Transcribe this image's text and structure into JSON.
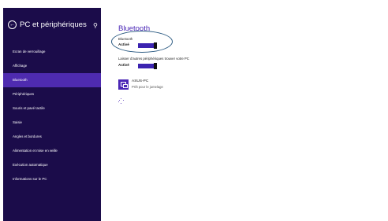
{
  "sidebar": {
    "title": "PC et périphériques",
    "back_icon": "back-arrow-icon",
    "search_icon": "search-icon",
    "items": [
      {
        "label": "Ecran de verrouillage"
      },
      {
        "label": "Affichage"
      },
      {
        "label": "Bluetooth"
      },
      {
        "label": "Périphériques"
      },
      {
        "label": "Souris et pavé tactile"
      },
      {
        "label": "Saisie"
      },
      {
        "label": "Angles et bordures"
      },
      {
        "label": "Alimentation et mise en veille"
      },
      {
        "label": "Exécution automatique"
      },
      {
        "label": "Informations sur le PC"
      }
    ],
    "active_index": 2
  },
  "main": {
    "title": "Bluetooth",
    "bluetooth_label": "Bluetooth",
    "bluetooth_value": "Activé",
    "discover_label": "Laisser d'autres périphériques trouver votre PC",
    "discover_value": "Activé",
    "device": {
      "name": "ASUS-PC",
      "status": "Prêt pour le jumelage",
      "icon": "pc-device-icon"
    },
    "spinner_icon": "loading-spinner-icon"
  },
  "colors": {
    "sidebar_bg": "#1b0c4a",
    "active_bg": "#4e2bb0",
    "accent": "#4b27b6",
    "highlight_ring": "#2b5a82"
  }
}
